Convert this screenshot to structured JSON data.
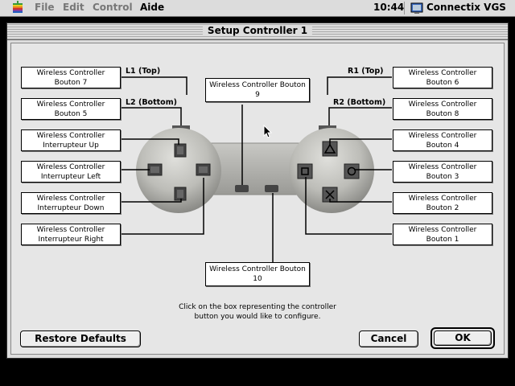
{
  "menubar": {
    "items": [
      "File",
      "Edit",
      "Control",
      "Aide"
    ],
    "clock": "10:44",
    "app_name": "Connectix VGS"
  },
  "dialog": {
    "title": "Setup Controller 1",
    "labels": {
      "l1": "L1 (Top)",
      "l2": "L2 (Bottom)",
      "r1": "R1 (Top)",
      "r2": "R2 (Bottom)"
    },
    "boxes": {
      "bouton7": [
        "Wireless Controller",
        "Bouton 7"
      ],
      "bouton5": [
        "Wireless Controller",
        "Bouton 5"
      ],
      "up": [
        "Wireless Controller",
        "Interrupteur  Up"
      ],
      "left": [
        "Wireless Controller",
        "Interrupteur  Left"
      ],
      "down": [
        "Wireless Controller",
        "Interrupteur  Down"
      ],
      "right": [
        "Wireless Controller",
        "Interrupteur  Right"
      ],
      "bouton9": [
        "Wireless Controller Bouton",
        "9"
      ],
      "bouton10": [
        "Wireless Controller Bouton",
        "10"
      ],
      "bouton6": [
        "Wireless Controller",
        "Bouton 6"
      ],
      "bouton8": [
        "Wireless Controller",
        "Bouton 8"
      ],
      "bouton4": [
        "Wireless Controller",
        "Bouton 4"
      ],
      "bouton3": [
        "Wireless Controller",
        "Bouton 3"
      ],
      "bouton2": [
        "Wireless Controller",
        "Bouton 2"
      ],
      "bouton1": [
        "Wireless Controller",
        "Bouton 1"
      ]
    },
    "instruction": [
      "Click on the box representing the controller",
      "button you would like to configure."
    ],
    "buttons": {
      "restore": "Restore Defaults",
      "cancel": "Cancel",
      "ok": "OK"
    }
  }
}
